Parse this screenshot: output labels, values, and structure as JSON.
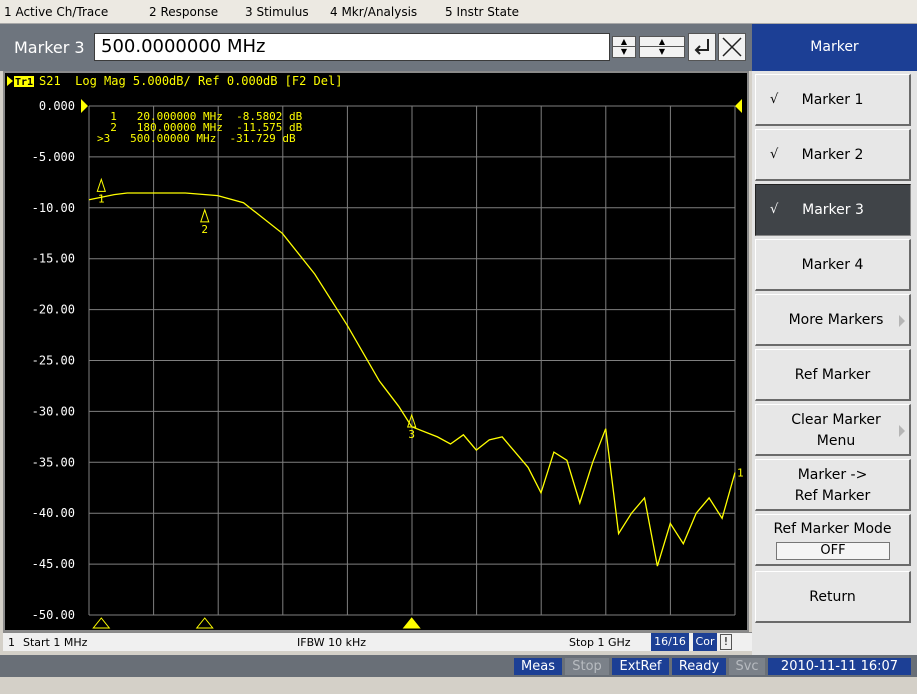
{
  "menu": [
    "1 Active Ch/Trace",
    "2 Response",
    "3 Stimulus",
    "4 Mkr/Analysis",
    "5 Instr State"
  ],
  "entry": {
    "label": "Marker 3",
    "value": "500.0000000 MHz"
  },
  "trace_header": {
    "trace_id": "Tr1",
    "text": "S21  Log Mag 5.000dB/ Ref 0.000dB [F2 Del]"
  },
  "marker_readout": [
    "  1   20.000000 MHz  -8.5802 dB",
    "  2   180.00000 MHz  -11.575 dB",
    ">3   500.00000 MHz  -31.729 dB"
  ],
  "status": {
    "channel": "1",
    "start": "Start 1 MHz",
    "ifbw": "IFBW 10 kHz",
    "stop": "Stop 1 GHz",
    "pages": "16/16",
    "cor": "Cor",
    "warn": "!"
  },
  "bottom": {
    "meas": "Meas",
    "stop": "Stop",
    "extref": "ExtRef",
    "ready": "Ready",
    "svc": "Svc",
    "datetime": "2010-11-11 16:07"
  },
  "panel": {
    "title": "Marker",
    "check": "√",
    "marker1": "Marker 1",
    "marker2": "Marker 2",
    "marker3": "Marker 3",
    "marker4": "Marker 4",
    "more_markers": "More Markers",
    "ref_marker": "Ref Marker",
    "clear_line1": "Clear Marker",
    "clear_line2": "Menu",
    "mkr_ref_line1": "Marker ->",
    "mkr_ref_line2": "Ref Marker",
    "ref_marker_mode": "Ref Marker Mode",
    "ref_marker_mode_value": "OFF",
    "return": "Return"
  },
  "colors": {
    "trace": "#ffff00",
    "grid": "#7f7f7f",
    "accent": "#1c3f95",
    "background": "#000000"
  },
  "chart_data": {
    "type": "line",
    "x_unit": "Hz",
    "y_unit": "dB",
    "xlim": [
      1000000,
      1000000000
    ],
    "ylim": [
      -50,
      0
    ],
    "ytick_labels": [
      "0.000",
      "-5.000",
      "-10.00",
      "-15.00",
      "-20.00",
      "-25.00",
      "-30.00",
      "-35.00",
      "-40.00",
      "-45.00",
      "-50.00"
    ],
    "grid": true,
    "series": [
      {
        "x": [
          1000000,
          40000000,
          60000000,
          150000000,
          200000000,
          240000000,
          300000000,
          350000000,
          400000000,
          450000000,
          480000000,
          500000000,
          540000000,
          560000000,
          580000000,
          600000000,
          620000000,
          640000000,
          660000000,
          680000000,
          700000000,
          720000000,
          740000000,
          760000000,
          780000000,
          800000000,
          820000000,
          840000000,
          860000000,
          880000000,
          900000000,
          920000000,
          940000000,
          960000000,
          980000000,
          1000000000
        ],
        "y": [
          -9.2,
          -8.7,
          -8.55,
          -8.55,
          -8.8,
          -9.5,
          -12.5,
          -16.5,
          -21.5,
          -27.0,
          -29.5,
          -31.5,
          -32.5,
          -33.2,
          -32.3,
          -33.8,
          -32.8,
          -32.5,
          -34.0,
          -35.5,
          -38.0,
          -34.0,
          -34.8,
          -39.0,
          -35.0,
          -31.7,
          -42.0,
          -40.0,
          -38.5,
          -45.2,
          -41.0,
          -43.0,
          -40.0,
          -38.5,
          -40.5,
          -36.0
        ]
      }
    ],
    "markers": [
      {
        "id": "1",
        "x": 20000000,
        "y": -8.5802
      },
      {
        "id": "2",
        "x": 180000000,
        "y": -11.575
      },
      {
        "id": "3",
        "x": 500000000,
        "y": -31.729,
        "active": true
      }
    ],
    "end_marker_label": "1",
    "ref_level": 0
  }
}
